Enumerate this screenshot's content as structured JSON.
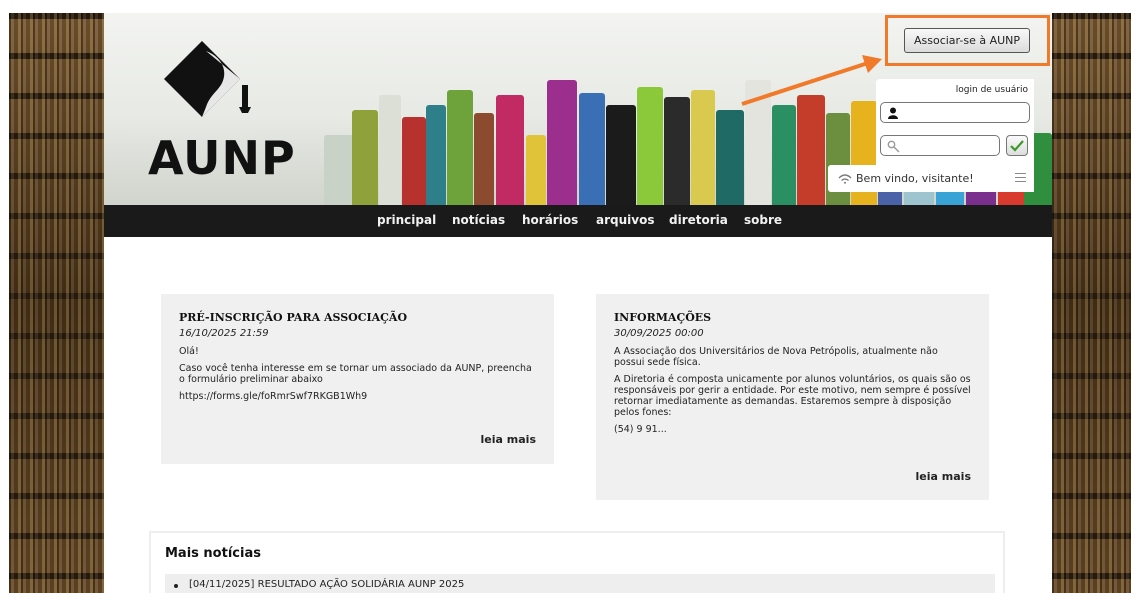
{
  "brand": {
    "logo_text": "AUNP"
  },
  "header": {
    "join_button": "Associar-se à AUNP",
    "login_label": "login de usuário",
    "welcome_text": "Bem vindo, visitante!",
    "accent_color": "#f07a2a"
  },
  "nav": {
    "items": [
      {
        "label": "principal"
      },
      {
        "label": "notícias"
      },
      {
        "label": "horários"
      },
      {
        "label": "arquivos"
      },
      {
        "label": "diretoria"
      },
      {
        "label": "sobre"
      }
    ]
  },
  "posts": [
    {
      "title": "PRÉ-INSCRIÇÃO PARA ASSOCIAÇÃO",
      "date": "16/10/2025 21:59",
      "paragraphs": [
        "Olá!",
        "Caso você tenha interesse em se tornar um associado da AUNP, preencha o formulário preliminar abaixo",
        "https://forms.gle/foRmrSwf7RKGB1Wh9"
      ],
      "read_more": "leia mais"
    },
    {
      "title": "INFORMAÇÕES",
      "date": "30/09/2025 00:00",
      "paragraphs": [
        "A Associação dos Universitários de Nova Petrópolis, atualmente não possui sede física.",
        "A Diretoria é composta unicamente por alunos voluntários, os quais são os responsáveis por gerir a entidade. Por este motivo, nem sempre é possível retornar imediatamente as demandas. Estaremos sempre à disposição pelos fones:",
        "(54) 9 91..."
      ],
      "read_more": "leia mais"
    }
  ],
  "more_news": {
    "title": "Mais notícias",
    "items": [
      {
        "label": "[04/11/2025] RESULTADO AÇÃO SOLIDÁRIA AUNP 2025"
      }
    ]
  },
  "icons": {
    "user": "user-icon",
    "key": "key-icon",
    "check": "check-icon",
    "wifi": "wifi-icon",
    "menu": "menu-icon"
  }
}
